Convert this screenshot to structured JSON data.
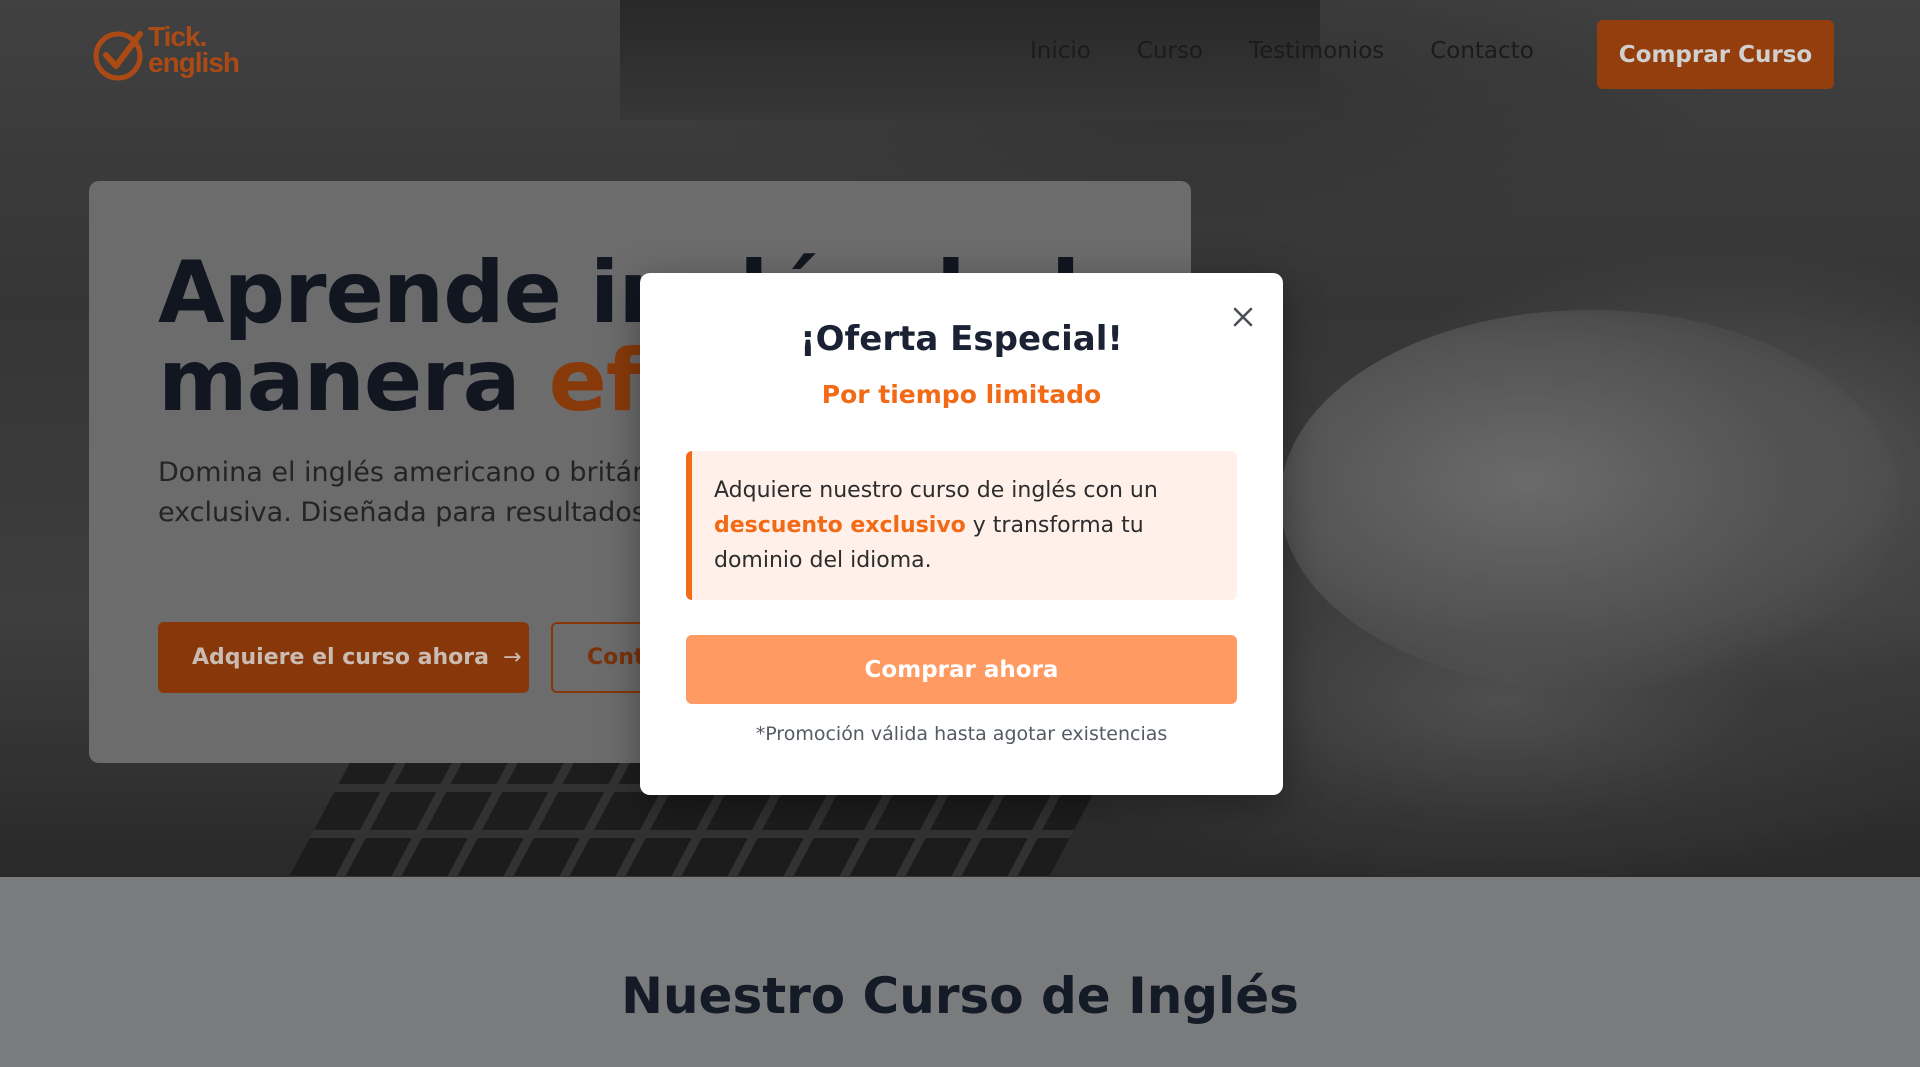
{
  "brand": {
    "logo_line1": "Tick.",
    "logo_line2": "english",
    "accent_color": "#f26a16"
  },
  "header": {
    "nav": [
      "Inicio",
      "Curso",
      "Testimonios",
      "Contacto"
    ],
    "cta_label": "Comprar Curso"
  },
  "hero": {
    "title_line1": "Aprende inglés de la",
    "title_line2_prefix": "manera ",
    "title_line2_accent": "eficaz",
    "description": "Domina el inglés americano o británico con nuestra metodología exclusiva. Diseñada para resultados rápidos y duraderos.",
    "primary_button": "Adquiere el curso ahora",
    "primary_button_icon": "arrow-right-icon",
    "secondary_button": "Contáctanos"
  },
  "section": {
    "title": "Nuestro Curso de Inglés"
  },
  "modal": {
    "title": "¡Oferta Especial!",
    "subtitle": "Por tiempo limitado",
    "body_prefix": "Adquiere nuestro curso de inglés con un ",
    "body_highlight": "descuento exclusivo",
    "body_suffix": " y transforma tu dominio del idioma.",
    "cta_label": "Comprar ahora",
    "note": "*Promoción válida hasta agotar existencias",
    "close_icon": "close-icon"
  }
}
